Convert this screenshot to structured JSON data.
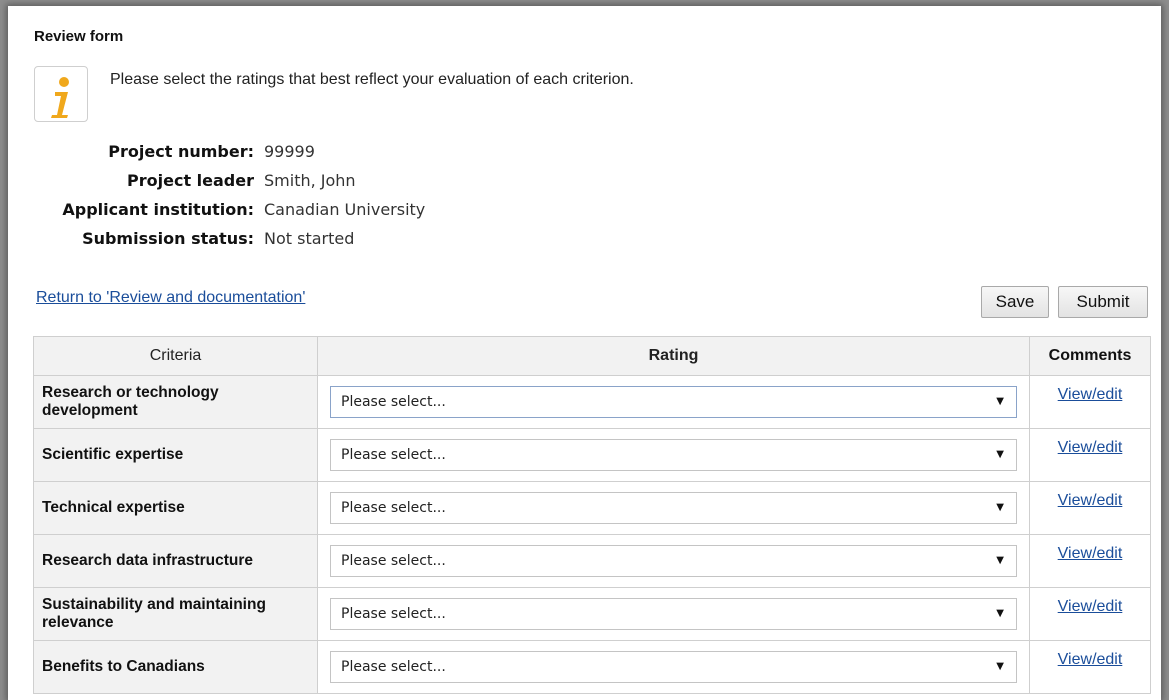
{
  "form": {
    "title": "Review form",
    "info_text": "Please select the ratings that best reflect your evaluation of each criterion.",
    "info_icon": "info-icon"
  },
  "meta": [
    {
      "label": "Project number:",
      "value": "99999"
    },
    {
      "label": "Project leader",
      "value": "Smith, John"
    },
    {
      "label": "Applicant institution:",
      "value": "Canadian University"
    },
    {
      "label": "Submission status:",
      "value": "Not started"
    }
  ],
  "actions": {
    "return_link": "Return to 'Review and documentation'",
    "save_label": "Save",
    "submit_label": "Submit"
  },
  "table": {
    "headers": {
      "criteria": "Criteria",
      "rating": "Rating",
      "comments": "Comments"
    },
    "rows": [
      {
        "criterion": "Research or technology development",
        "rating": "Please select...",
        "comment_link": "View/edit"
      },
      {
        "criterion": "Scientific expertise",
        "rating": "Please select...",
        "comment_link": "View/edit"
      },
      {
        "criterion": "Technical expertise",
        "rating": "Please select...",
        "comment_link": "View/edit"
      },
      {
        "criterion": "Research data infrastructure",
        "rating": "Please select...",
        "comment_link": "View/edit"
      },
      {
        "criterion": "Sustainability and maintaining relevance",
        "rating": "Please select...",
        "comment_link": "View/edit"
      },
      {
        "criterion": "Benefits to Canadians",
        "rating": "Please select...",
        "comment_link": "View/edit"
      }
    ]
  },
  "colors": {
    "link": "#1a4d9a",
    "info_icon": "#f0a81c",
    "header_bg": "#f2f2f2"
  }
}
